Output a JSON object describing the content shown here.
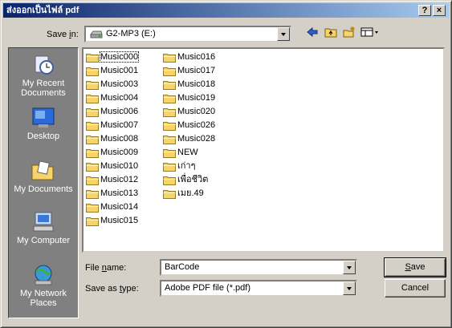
{
  "window": {
    "title": "ส่งออกเป็นไฟล์ pdf",
    "help_btn": "?",
    "close_btn": "×"
  },
  "save_in": {
    "label_pre": "Save ",
    "label_accel": "i",
    "label_post": "n:",
    "value": "G2-MP3 (E:)"
  },
  "toolbar": {
    "back_icon": "back-arrow-icon",
    "up_icon": "up-folder-icon",
    "new_folder_icon": "new-folder-icon",
    "view_icon": "view-menu-icon"
  },
  "places": [
    {
      "label": "My Recent Documents",
      "icon": "recent-documents-icon"
    },
    {
      "label": "Desktop",
      "icon": "desktop-icon"
    },
    {
      "label": "My Documents",
      "icon": "my-documents-icon"
    },
    {
      "label": "My Computer",
      "icon": "my-computer-icon"
    },
    {
      "label": "My Network Places",
      "icon": "network-places-icon"
    }
  ],
  "folders_col1": [
    "Music000",
    "Music001",
    "Music003",
    "Music004",
    "Music006",
    "Music007",
    "Music008",
    "Music009",
    "Music010",
    "Music012",
    "Music013",
    "Music014",
    "Music015"
  ],
  "folders_col2": [
    "Music016",
    "Music017",
    "Music018",
    "Music019",
    "Music020",
    "Music026",
    "Music028",
    "NEW",
    "เก่าๆ",
    "เพื่อชีวิต",
    "เมย.49"
  ],
  "file_name": {
    "label_pre": "File ",
    "label_accel": "n",
    "label_post": "ame:",
    "value": "BarCode"
  },
  "save_type": {
    "label_pre": "Save as ",
    "label_accel": "t",
    "label_post": "ype:",
    "value": "Adobe PDF file (*.pdf)"
  },
  "buttons": {
    "save_accel": "S",
    "save_rest": "ave",
    "cancel": "Cancel"
  }
}
